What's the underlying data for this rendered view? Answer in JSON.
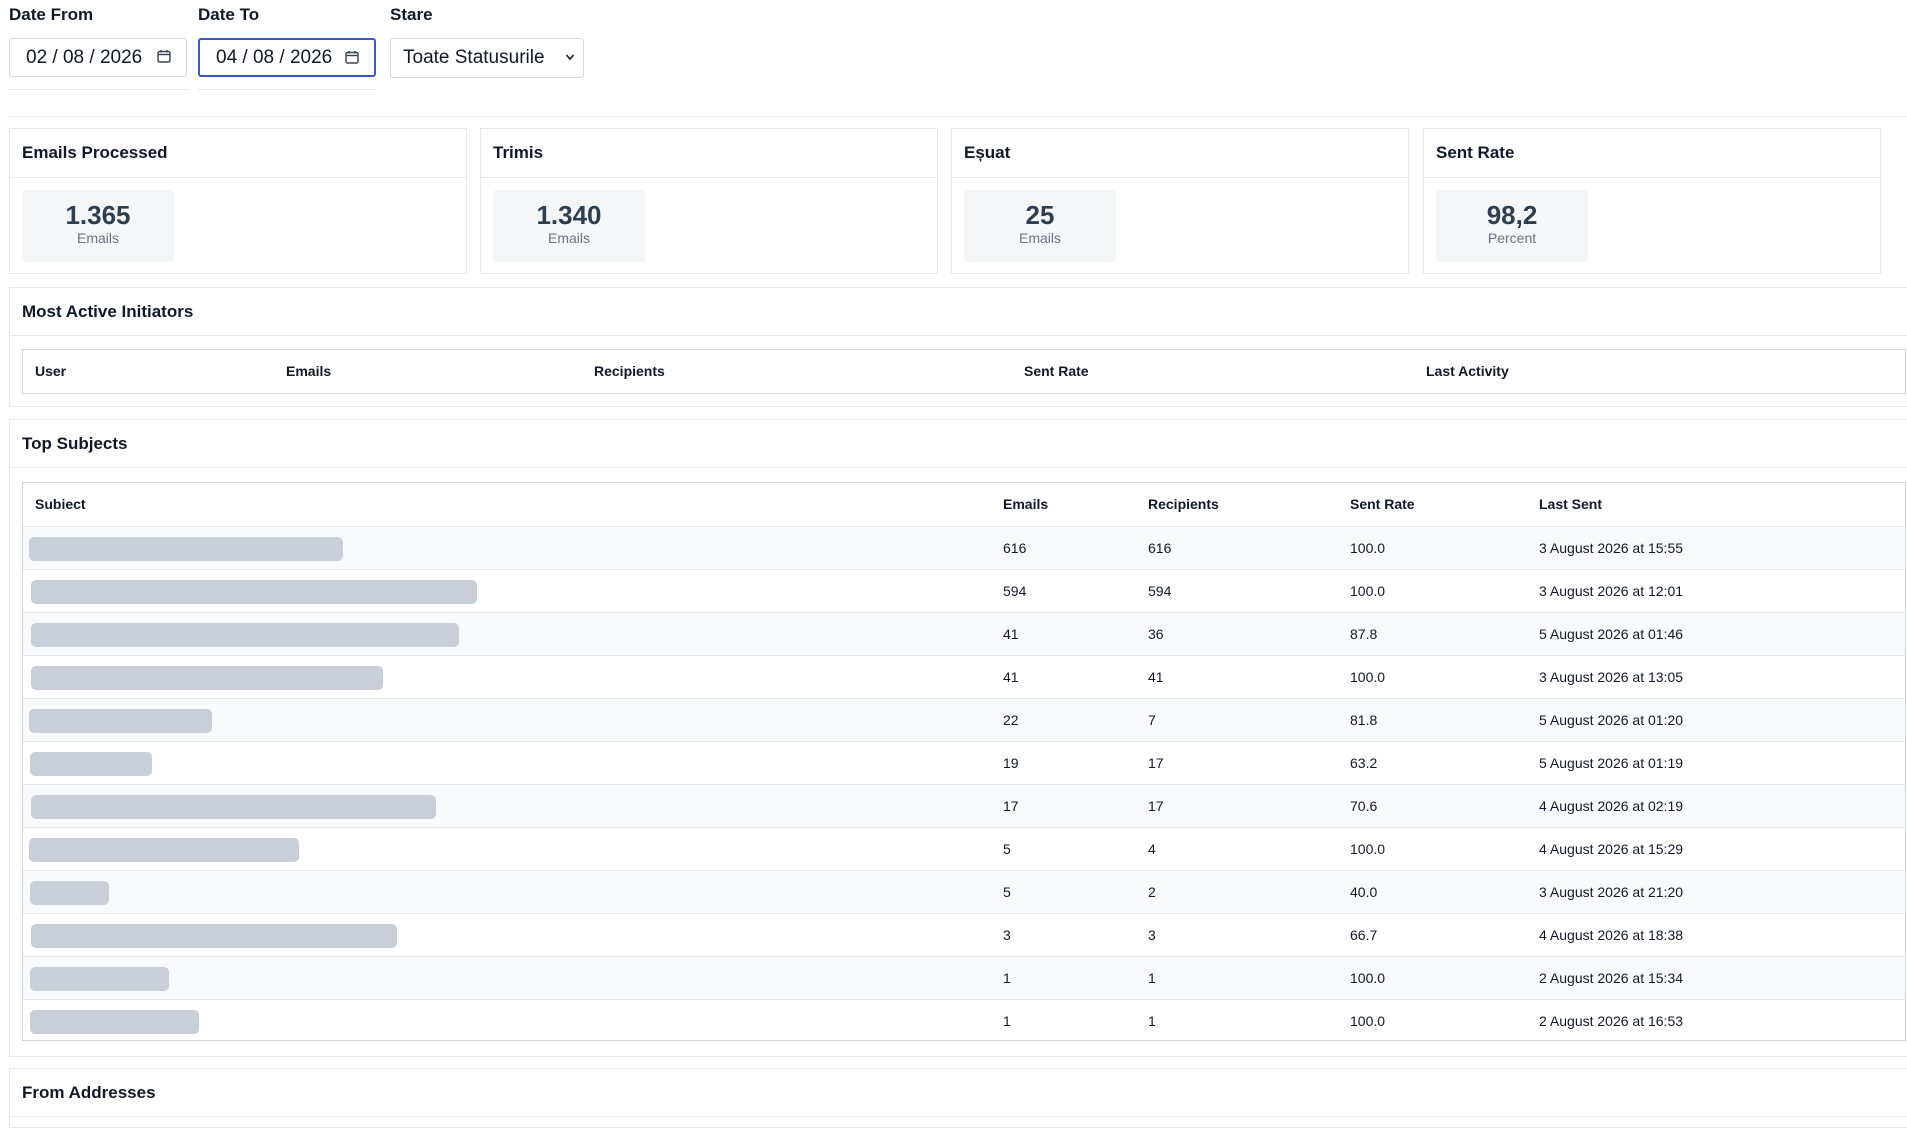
{
  "filters": {
    "date_from": {
      "label": "Date From",
      "value": "02 / 08 / 2026"
    },
    "date_to": {
      "label": "Date To",
      "value": "04 / 08 / 2026"
    },
    "status": {
      "label": "Stare",
      "value": "Toate Statusurile"
    }
  },
  "stats": [
    {
      "title": "Emails Processed",
      "value": "1.365",
      "unit": "Emails"
    },
    {
      "title": "Trimis",
      "value": "1.340",
      "unit": "Emails"
    },
    {
      "title": "Eșuat",
      "value": "25",
      "unit": "Emails"
    },
    {
      "title": "Sent Rate",
      "value": "98,2",
      "unit": "Percent"
    }
  ],
  "initiators": {
    "title": "Most Active Initiators",
    "columns": [
      "User",
      "Emails",
      "Recipients",
      "Sent Rate",
      "Last Activity"
    ]
  },
  "top_subjects": {
    "title": "Top Subjects",
    "columns": [
      "Subiect",
      "Emails",
      "Recipients",
      "Sent Rate",
      "Last Sent"
    ],
    "rows": [
      {
        "emails": "616",
        "recipients": "616",
        "sent_rate": "100.0",
        "last_sent": "3 August 2026 at 15:55"
      },
      {
        "emails": "594",
        "recipients": "594",
        "sent_rate": "100.0",
        "last_sent": "3 August 2026 at 12:01"
      },
      {
        "emails": "41",
        "recipients": "36",
        "sent_rate": "87.8",
        "last_sent": "5 August 2026 at 01:46"
      },
      {
        "emails": "41",
        "recipients": "41",
        "sent_rate": "100.0",
        "last_sent": "3 August 2026 at 13:05"
      },
      {
        "emails": "22",
        "recipients": "7",
        "sent_rate": "81.8",
        "last_sent": "5 August 2026 at 01:20"
      },
      {
        "emails": "19",
        "recipients": "17",
        "sent_rate": "63.2",
        "last_sent": "5 August 2026 at 01:19"
      },
      {
        "emails": "17",
        "recipients": "17",
        "sent_rate": "70.6",
        "last_sent": "4 August 2026 at 02:19"
      },
      {
        "emails": "5",
        "recipients": "4",
        "sent_rate": "100.0",
        "last_sent": "4 August 2026 at 15:29"
      },
      {
        "emails": "5",
        "recipients": "2",
        "sent_rate": "40.0",
        "last_sent": "3 August 2026 at 21:20"
      },
      {
        "emails": "3",
        "recipients": "3",
        "sent_rate": "66.7",
        "last_sent": "4 August 2026 at 18:38"
      },
      {
        "emails": "1",
        "recipients": "1",
        "sent_rate": "100.0",
        "last_sent": "2 August 2026 at 15:34"
      },
      {
        "emails": "1",
        "recipients": "1",
        "sent_rate": "100.0",
        "last_sent": "2 August 2026 at 16:53"
      }
    ]
  },
  "from_addresses": {
    "title": "From Addresses"
  }
}
